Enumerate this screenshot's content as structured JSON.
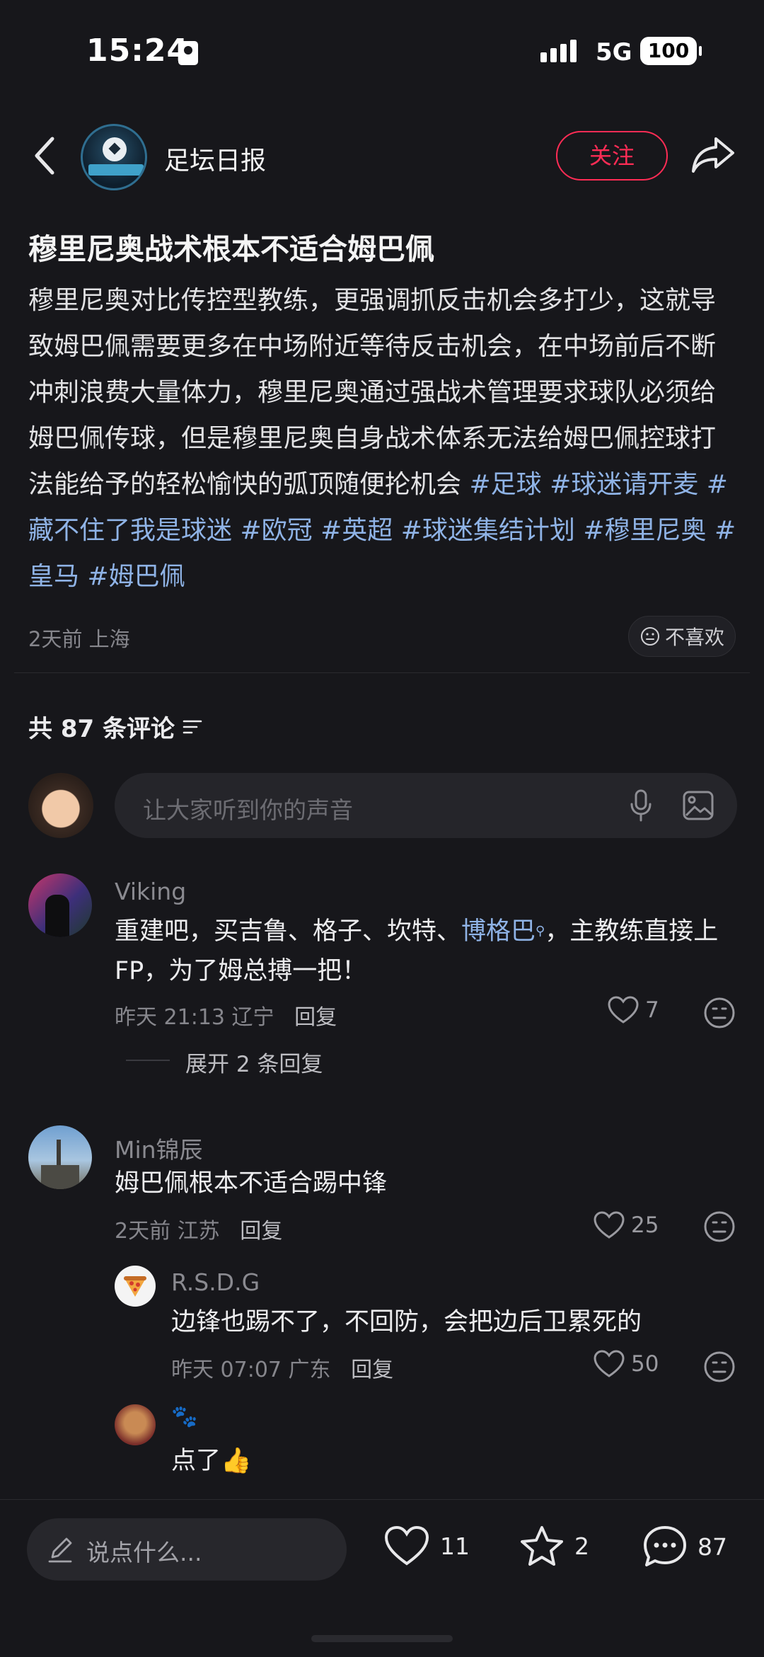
{
  "status_bar": {
    "time": "15:24",
    "network": "5G",
    "battery": "100"
  },
  "header": {
    "author": "足坛日报",
    "follow_label": "关注"
  },
  "post": {
    "title": "穆里尼奥战术根本不适合姆巴佩",
    "body": "穆里尼奥对比传控型教练，更强调抓反击机会多打少，这就导致姆巴佩需要更多在中场附近等待反击机会，在中场前后不断冲刺浪费大量体力，穆里尼奥通过强战术管理要求球队必须给姆巴佩传球，但是穆里尼奥自身战术体系无法给姆巴佩控球打法能给予的轻松愉快的弧顶随便抡机会",
    "tags": [
      "#足球",
      "#球迷请开麦",
      "#藏不住了我是球迷",
      "#欧冠",
      "#英超",
      "#球迷集结计划",
      "#穆里尼奥",
      "#皇马",
      "#姆巴佩"
    ],
    "meta": "2天前 上海",
    "dislike_label": "不喜欢"
  },
  "comments_header": {
    "count_label": "共 87 条评论"
  },
  "comment_input": {
    "placeholder": "让大家听到你的声音"
  },
  "comments": [
    {
      "user": "Viking",
      "text_before": "重建吧，买吉鲁、格子、坎特、",
      "text_link": "博格巴",
      "text_after": "，主教练直接上FP，为了姆总搏一把！",
      "meta": "昨天 21:13 辽宁",
      "reply_label": "回复",
      "likes": "7",
      "expand_label": "展开 2 条回复"
    },
    {
      "user": "Min锦辰",
      "text": "姆巴佩根本不适合踢中锋",
      "meta": "2天前 江苏",
      "reply_label": "回复",
      "likes": "25"
    },
    {
      "user": "R.S.D.G",
      "text": "边锋也踢不了，不回防，会把边后卫累死的",
      "meta": "昨天 07:07 广东",
      "reply_label": "回复",
      "likes": "50"
    },
    {
      "user": "🐾",
      "text": "点了👍"
    }
  ],
  "bottom_bar": {
    "placeholder": "说点什么...",
    "likes": "11",
    "favorites": "2",
    "comments": "87"
  },
  "colors": {
    "background": "#17171b",
    "accent": "#ff2c55",
    "tag": "#8fb3e6"
  }
}
